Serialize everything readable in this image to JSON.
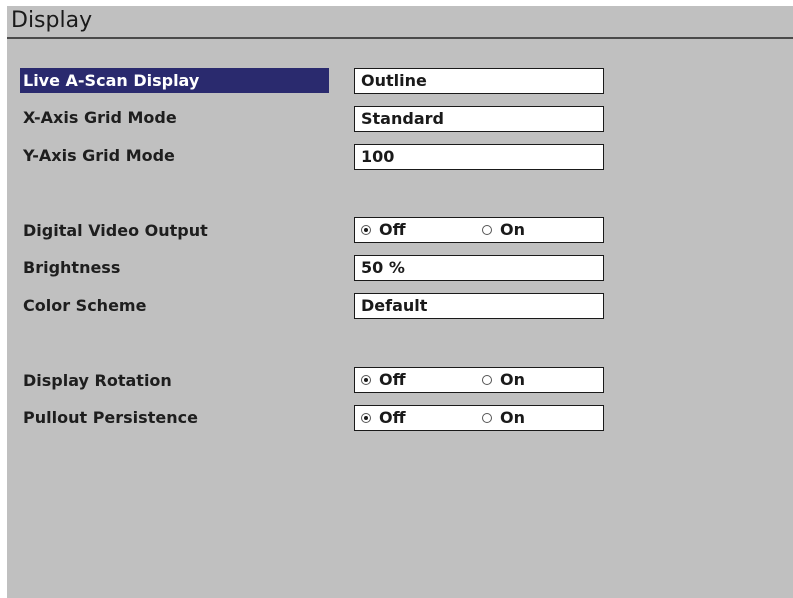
{
  "title": "Display",
  "settings": {
    "live_ascan_display": {
      "label": "Live A-Scan Display",
      "value": "Outline"
    },
    "x_axis_grid_mode": {
      "label": "X-Axis Grid Mode",
      "value": "Standard"
    },
    "y_axis_grid_mode": {
      "label": "Y-Axis Grid Mode",
      "value": "100"
    },
    "digital_video_output": {
      "label": "Digital Video Output",
      "options": [
        "Off",
        "On"
      ],
      "selected": "Off"
    },
    "brightness": {
      "label": "Brightness",
      "value": "50 %"
    },
    "color_scheme": {
      "label": "Color Scheme",
      "value": "Default"
    },
    "display_rotation": {
      "label": "Display Rotation",
      "options": [
        "Off",
        "On"
      ],
      "selected": "Off"
    },
    "pullout_persistence": {
      "label": "Pullout Persistence",
      "options": [
        "Off",
        "On"
      ],
      "selected": "Off"
    }
  },
  "colors": {
    "background": "#c0c0c0",
    "selection": "#2a2a6e",
    "field_background": "#ffffff"
  }
}
